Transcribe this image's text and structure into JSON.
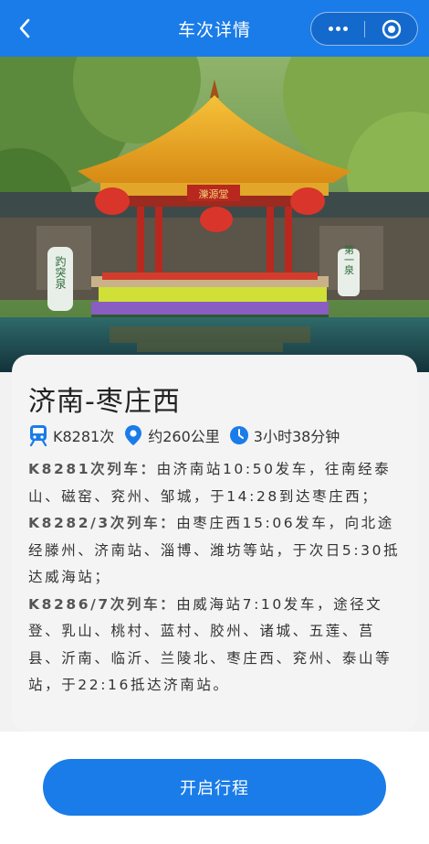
{
  "nav": {
    "title": "车次详情",
    "icons": {
      "back": "chevron-left-icon",
      "more": "more-dots-icon",
      "close": "target-close-icon"
    }
  },
  "hero": {
    "plaque": "濼源堂",
    "stele_left": "趵突泉",
    "stele_right": "第一泉"
  },
  "route": {
    "title": "济南-枣庄西",
    "train_no": "K8281次",
    "distance": "约260公里",
    "duration": "3小时38分钟",
    "icons": {
      "train": "train-icon",
      "distance": "location-pin-icon",
      "duration": "clock-icon"
    }
  },
  "schedule": [
    {
      "label": "K8281次列车：",
      "text": "由济南站10:50发车，往南经泰山、磁窑、兖州、邹城，于14:28到达枣庄西；"
    },
    {
      "label": "K8282/3次列车：",
      "text": "由枣庄西15:06发车，向北途经滕州、济南站、淄博、潍坊等站，于次日5:30抵达威海站；"
    },
    {
      "label": "K8286/7次列车：",
      "text": "由威海站7:10发车，途径文登、乳山、桃村、蓝村、胶州、诸城、五莲、莒县、沂南、临沂、兰陵北、枣庄西、兖州、泰山等站，于22:16抵达济南站。"
    }
  ],
  "footer": {
    "button_label": "开启行程"
  },
  "colors": {
    "primary": "#1a7ce8",
    "card_bg": "#f4f4f4",
    "text": "#333333"
  }
}
